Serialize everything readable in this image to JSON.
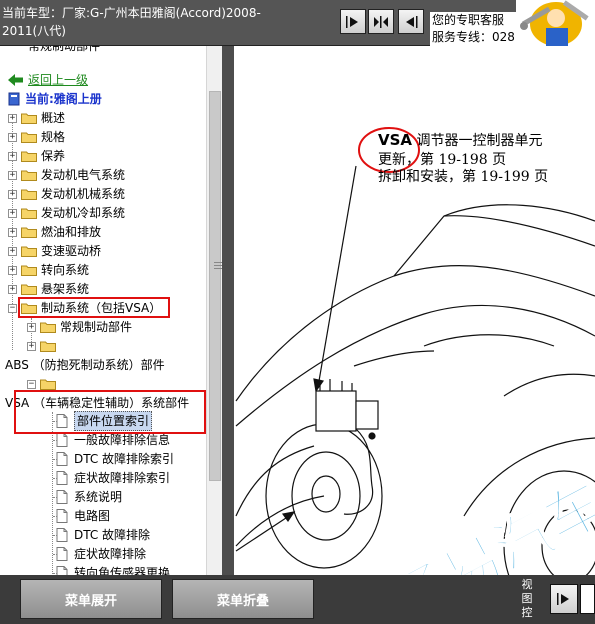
{
  "header": {
    "car_line1": "当前车型：厂家:G-广州本田雅阁(Accord)2008-",
    "car_line2": "2011(八代)",
    "service_line1": "您的专职客服",
    "service_line2": "服务专线：028"
  },
  "tree": {
    "back": "返回上一级",
    "current": "当前:雅阁上册",
    "partial_top": "常规制动部件",
    "items": [
      {
        "label": "概述"
      },
      {
        "label": "规格"
      },
      {
        "label": "保养"
      },
      {
        "label": "发动机电气系统"
      },
      {
        "label": "发动机机械系统"
      },
      {
        "label": "发动机冷却系统"
      },
      {
        "label": "燃油和排放"
      },
      {
        "label": "变速驱动桥"
      },
      {
        "label": "转向系统"
      },
      {
        "label": "悬架系统"
      },
      {
        "label": "制动系统（包括VSA）"
      }
    ],
    "brake_children": {
      "regular": "常规制动部件",
      "abs": "ABS （防抱死制动系统）部件",
      "vsa": "VSA （车辆稳定性辅助）系统部件"
    },
    "vsa_children": [
      "部件位置索引",
      "一般故障排除信息",
      "DTC 故障排除索引",
      "症状故障排除索引",
      "系统说明",
      "电路图",
      "DTC 故障排除",
      "症状故障排除",
      "转向角传感器更换"
    ]
  },
  "content": {
    "callout_title_bold": "VSA",
    "callout_title_rest": " 调节器一控制器单元",
    "callout_line2": "更新，第 19-198 页",
    "callout_line3": "拆卸和安装，第 19-199 页",
    "watermark": "畅易汽车维"
  },
  "footer": {
    "expand": "菜单展开",
    "collapse": "菜单折叠",
    "view_label": "视图控"
  },
  "colors": {
    "highlight_red": "#e01010",
    "link_blue": "#1a33cc",
    "back_green": "#1f8a1f",
    "watermark_blue": "#2a9fd8"
  }
}
